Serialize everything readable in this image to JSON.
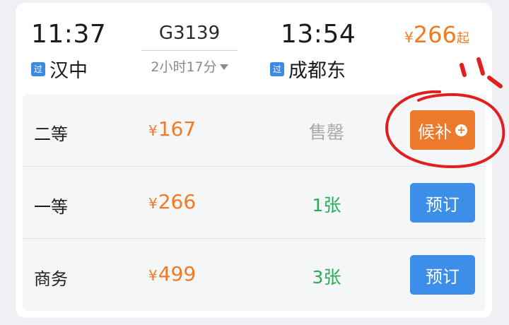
{
  "colors": {
    "price_orange": "#f27a24",
    "available_green": "#27ad57",
    "sold_out_gray": "#a8a8a8",
    "book_blue": "#3c8ee8",
    "waitlist_orange": "#ec7a2b",
    "annotation_red": "#e02020"
  },
  "train": {
    "departure_time": "11:37",
    "arrival_time": "13:54",
    "number": "G3139",
    "duration": "2小时17分",
    "departure_station": "汉中",
    "arrival_station": "成都东",
    "pass_badge": "过",
    "lowest_price_symbol": "¥",
    "lowest_price": "266",
    "lowest_price_suffix": "起"
  },
  "seats": [
    {
      "name": "二等",
      "symbol": "¥",
      "price": "167",
      "stock": "售罄",
      "action": "候补"
    },
    {
      "name": "一等",
      "symbol": "¥",
      "price": "266",
      "stock": "1张",
      "action": "预订"
    },
    {
      "name": "商务",
      "symbol": "¥",
      "price": "499",
      "stock": "3张",
      "action": "预订"
    }
  ],
  "icons": {
    "waitlist_plus": "+",
    "duration_toggle": "chevron-down-icon"
  }
}
